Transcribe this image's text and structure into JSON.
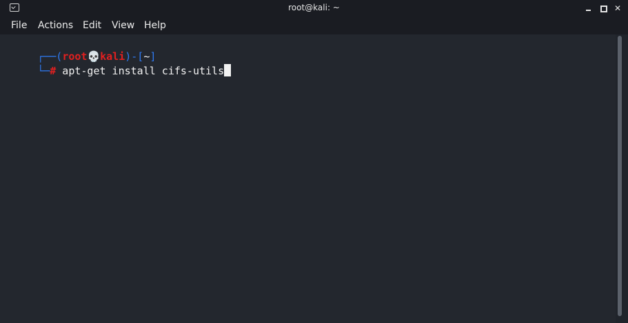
{
  "window": {
    "title": "root@kali: ~",
    "controls": {
      "minimize": "minimize",
      "maximize": "maximize",
      "close": "close"
    }
  },
  "menu": {
    "items": [
      "File",
      "Actions",
      "Edit",
      "View",
      "Help"
    ]
  },
  "prompt": {
    "box_left": "┌──(",
    "user": "root",
    "skull": "💀",
    "host": "kali",
    "box_mid": ")-[",
    "path": "~",
    "box_right": "]",
    "line2_prefix": "└─",
    "symbol": "#",
    "command": " apt-get install cifs-utils"
  },
  "colors": {
    "background": "#23272e",
    "prompt_box": "#2f7bf3",
    "prompt_user": "#e02020",
    "text": "#f2f2f2"
  },
  "icons": {
    "app": "terminal-icon",
    "minimize": "minimize-icon",
    "maximize": "maximize-icon",
    "close": "close-icon",
    "logo": "kali-dragon-logo"
  }
}
